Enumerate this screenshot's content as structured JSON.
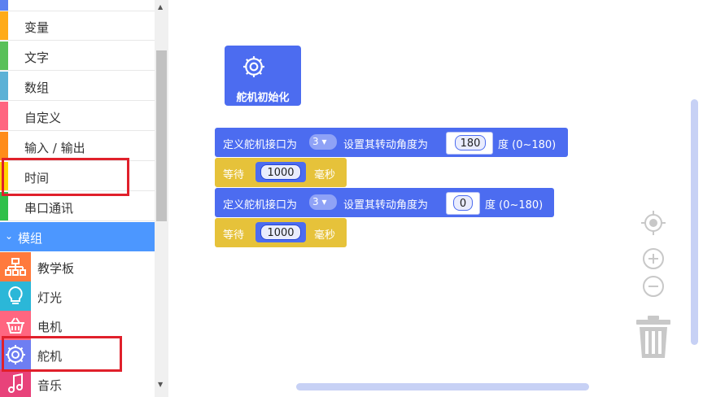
{
  "sidebar": {
    "categories": [
      {
        "label": "变量",
        "color": "#ffab19"
      },
      {
        "label": "文字",
        "color": "#59c059"
      },
      {
        "label": "数组",
        "color": "#5cb1d6"
      },
      {
        "label": "自定义",
        "color": "#ff6680"
      },
      {
        "label": "输入 / 输出",
        "color": "#ff8c1a"
      },
      {
        "label": "时间",
        "color": "#ffd500"
      },
      {
        "label": "串口通讯",
        "color": "#2fc04a"
      }
    ],
    "group": {
      "label": "模组",
      "chevron": "›"
    },
    "modules": [
      {
        "label": "教学板",
        "icon": "board-icon",
        "color": "#ff7a3d"
      },
      {
        "label": "灯光",
        "icon": "bulb-icon",
        "color": "#2bb7d8"
      },
      {
        "label": "电机",
        "icon": "basket-icon",
        "color": "#ff6680"
      },
      {
        "label": "舵机",
        "icon": "gear-icon",
        "color": "#6e7ef2"
      },
      {
        "label": "音乐",
        "icon": "music-icon",
        "color": "#e8427a"
      }
    ]
  },
  "workspace": {
    "init_block": {
      "label": "舵机初始化"
    },
    "blocks": [
      {
        "type": "servo",
        "prefix": "定义舵机接口为",
        "port": "3",
        "middle": "设置其转动角度为",
        "angle": "180",
        "suffix": "度 (0~180)"
      },
      {
        "type": "wait",
        "prefix": "等待",
        "value": "1000",
        "suffix": "毫秒"
      },
      {
        "type": "servo",
        "prefix": "定义舵机接口为",
        "port": "3",
        "middle": "设置其转动角度为",
        "angle": "0",
        "suffix": "度 (0~180)"
      },
      {
        "type": "wait",
        "prefix": "等待",
        "value": "1000",
        "suffix": "毫秒"
      }
    ]
  },
  "colors": {
    "accent": "#4c97ff",
    "block_blue": "#4c6cf0",
    "block_yellow": "#e6c23a",
    "highlight": "#e0202b"
  }
}
